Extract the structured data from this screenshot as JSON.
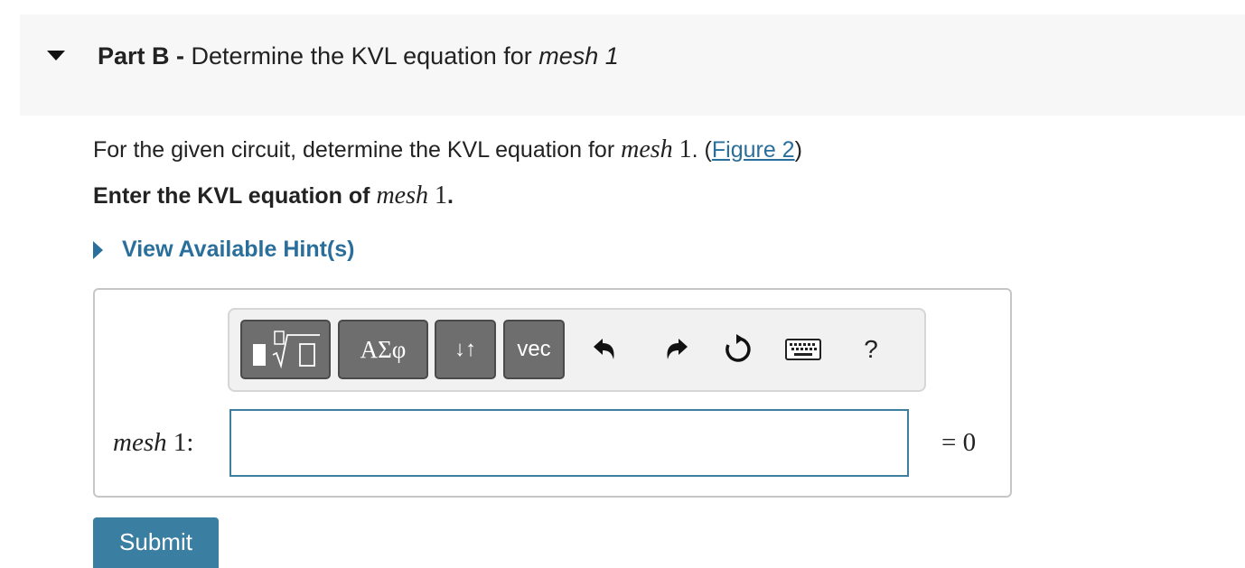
{
  "part": {
    "label": "Part B",
    "separator": " - ",
    "title_text": "Determine the KVL equation for ",
    "title_emph": "mesh 1"
  },
  "prompt": {
    "text_before": "For the given circuit, determine the KVL equation for ",
    "math_var": "mesh",
    "math_num": " 1",
    "text_after": ". (",
    "link": "Figure 2",
    "text_end": ")"
  },
  "instruction": {
    "text": "Enter the KVL equation of ",
    "math_var": "mesh",
    "math_num": " 1",
    "end": "."
  },
  "hint": {
    "label": "View Available Hint(s)"
  },
  "toolbar": {
    "greek_label": "ΑΣφ",
    "arrows_label": "↓↑",
    "vec_label": "vec",
    "help_label": "?"
  },
  "answer": {
    "label_var": "mesh",
    "label_num": " 1:",
    "value": "",
    "equals_text": "= 0"
  },
  "submit": {
    "label": "Submit"
  },
  "colors": {
    "link": "#2a6f9b",
    "button": "#3a7ea1",
    "toolbar_button": "#6e6e6e"
  }
}
